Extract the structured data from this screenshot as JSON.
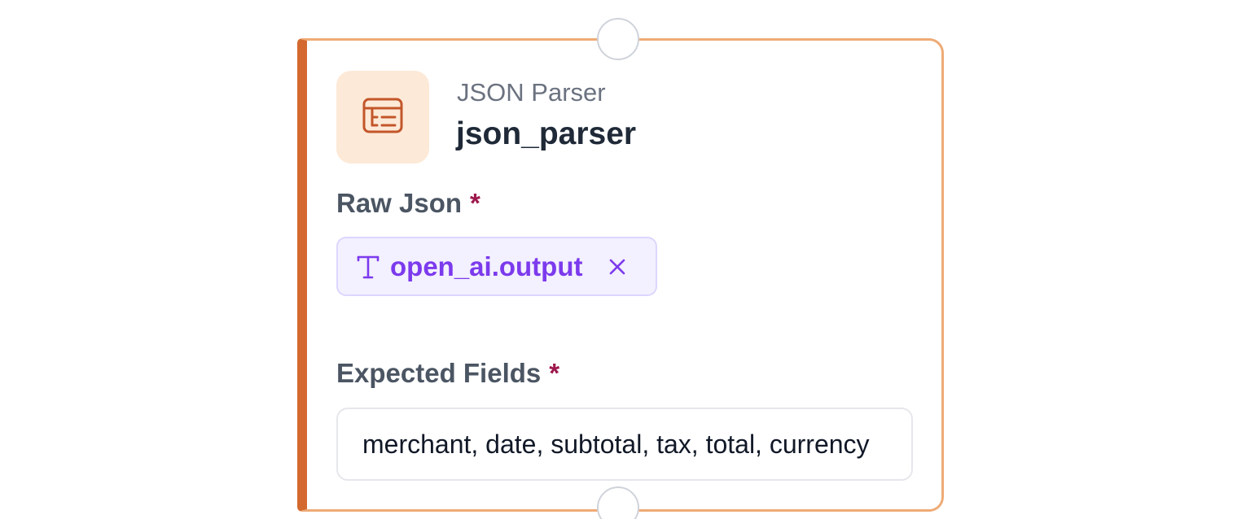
{
  "node": {
    "type_label": "JSON Parser",
    "name": "json_parser",
    "icon": "table-parser-icon",
    "accent_color": "#d4692f",
    "border_color": "#eeab76",
    "icon_bg_color": "#fde9d7"
  },
  "fields": {
    "raw_json": {
      "label": "Raw Json",
      "required_marker": "*",
      "chip": {
        "icon": "text-type-icon",
        "value": "open_ai.output",
        "remove_icon": "close-icon",
        "text_color": "#7c3aed",
        "bg_color": "#f3f0ff"
      }
    },
    "expected_fields": {
      "label": "Expected Fields",
      "required_marker": "*",
      "value": "merchant, date, subtotal, tax, total, currency"
    }
  },
  "handles": {
    "top": "input-handle",
    "bottom": "output-handle"
  }
}
